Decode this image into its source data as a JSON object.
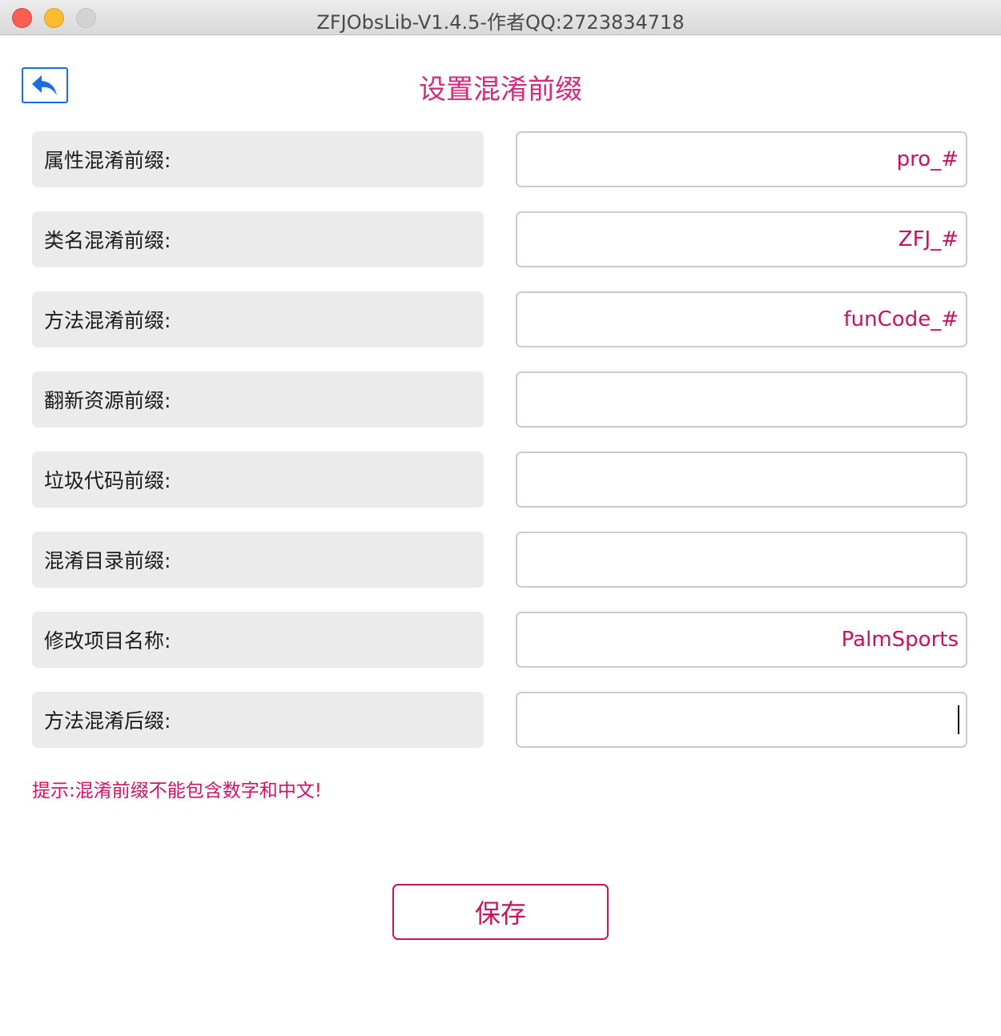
{
  "window": {
    "title": "ZFJObsLib-V1.4.5-作者QQ:2723834718"
  },
  "header": {
    "title": "设置混淆前缀",
    "back_icon": "reply-arrow-icon"
  },
  "fields": [
    {
      "label": "属性混淆前缀:",
      "value": "pro_#"
    },
    {
      "label": "类名混淆前缀:",
      "value": "ZFJ_#"
    },
    {
      "label": "方法混淆前缀:",
      "value": "funCode_#"
    },
    {
      "label": "翻新资源前缀:",
      "value": ""
    },
    {
      "label": "垃圾代码前缀:",
      "value": ""
    },
    {
      "label": "混淆目录前缀:",
      "value": ""
    },
    {
      "label": "修改项目名称:",
      "value": "PalmSports"
    },
    {
      "label": "方法混淆后缀:",
      "value": ""
    }
  ],
  "hint": "提示:混淆前缀不能包含数字和中文!",
  "save_label": "保存",
  "colors": {
    "accent": "#c8125f",
    "back_button": "#1a6fe0",
    "label_bg": "#ebebeb"
  }
}
